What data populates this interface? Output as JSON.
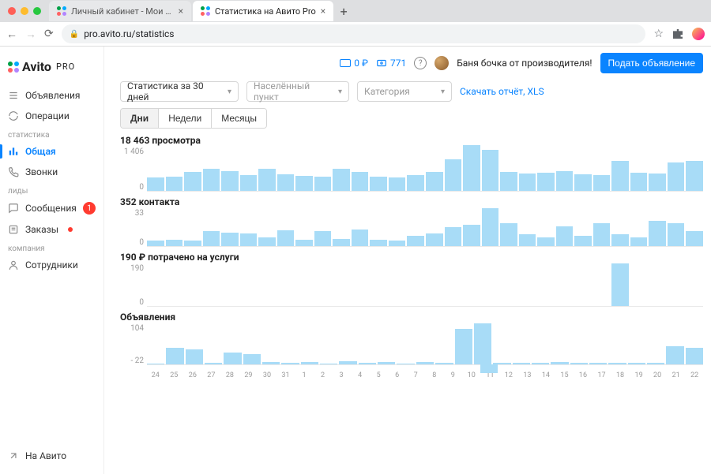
{
  "browser": {
    "tabs": [
      {
        "title": "Личный кабинет - Мои объяв",
        "active": false
      },
      {
        "title": "Статистика на Авито Pro",
        "active": true
      }
    ],
    "url": "pro.avito.ru/statistics"
  },
  "logo": {
    "brand": "Avito",
    "suffix": "PRO"
  },
  "sidebar": {
    "items": [
      {
        "label": "Объявления",
        "icon": "stack-icon"
      },
      {
        "label": "Операции",
        "icon": "refresh-icon"
      }
    ],
    "groups": [
      {
        "label": "статистика",
        "items": [
          {
            "label": "Общая",
            "icon": "bars-icon",
            "active": true
          },
          {
            "label": "Звонки",
            "icon": "phone-icon"
          }
        ]
      },
      {
        "label": "лиды",
        "items": [
          {
            "label": "Сообщения",
            "icon": "chat-icon",
            "badge": "1"
          },
          {
            "label": "Заказы",
            "icon": "list-icon",
            "dot": true
          }
        ]
      },
      {
        "label": "компания",
        "items": [
          {
            "label": "Сотрудники",
            "icon": "person-icon"
          }
        ]
      }
    ],
    "footer": {
      "label": "На Авито"
    }
  },
  "topbar": {
    "wallet": "0 ₽",
    "views": "771",
    "listing": "Баня бочка от производителя!",
    "cta": "Подать объявление"
  },
  "controls": {
    "period": "Статистика за 30 дней",
    "city_placeholder": "Населённый пункт",
    "category_placeholder": "Категория",
    "download": "Скачать отчёт, XLS",
    "granularity": {
      "day": "Дни",
      "week": "Недели",
      "month": "Месяцы"
    }
  },
  "charts": {
    "views_title": "18 463 просмотра",
    "contacts_title": "352 контакта",
    "spend_title": "190 ₽ потрачено на услуги",
    "ads_title": "Объявления",
    "y_views_top": "1 406",
    "y_views_bot": "0",
    "y_contacts_top": "33",
    "y_contacts_bot": "0",
    "y_spend_top": "190",
    "y_spend_bot": "0",
    "y_ads_top": "104",
    "y_ads_bot": "- 22"
  },
  "chart_data": [
    {
      "type": "bar",
      "title": "18 463 просмотра",
      "ylabel": "",
      "xlabel": "",
      "ylim": [
        0,
        1406
      ],
      "categories": [
        "24",
        "25",
        "26",
        "27",
        "28",
        "29",
        "30",
        "31",
        "1",
        "2",
        "3",
        "4",
        "5",
        "6",
        "7",
        "8",
        "9",
        "10",
        "11",
        "12",
        "13",
        "14",
        "15",
        "16",
        "17",
        "18",
        "19",
        "20",
        "21",
        "22"
      ],
      "values": [
        420,
        450,
        600,
        700,
        640,
        500,
        700,
        520,
        470,
        450,
        700,
        600,
        450,
        430,
        500,
        600,
        1000,
        1450,
        1300,
        600,
        550,
        580,
        630,
        540,
        510,
        950,
        580,
        560,
        900,
        950
      ]
    },
    {
      "type": "bar",
      "title": "352 контакта",
      "ylim": [
        0,
        33
      ],
      "categories": [
        "24",
        "25",
        "26",
        "27",
        "28",
        "29",
        "30",
        "31",
        "1",
        "2",
        "3",
        "4",
        "5",
        "6",
        "7",
        "8",
        "9",
        "10",
        "11",
        "12",
        "13",
        "14",
        "15",
        "16",
        "17",
        "18",
        "19",
        "20",
        "21",
        "22"
      ],
      "values": [
        5,
        6,
        5,
        14,
        13,
        12,
        8,
        15,
        6,
        14,
        7,
        16,
        6,
        5,
        10,
        12,
        18,
        20,
        36,
        22,
        11,
        8,
        19,
        10,
        22,
        11,
        8,
        24,
        22,
        14
      ]
    },
    {
      "type": "bar",
      "title": "190 ₽ потрачено на услуги",
      "ylim": [
        0,
        190
      ],
      "categories": [
        "24",
        "25",
        "26",
        "27",
        "28",
        "29",
        "30",
        "31",
        "1",
        "2",
        "3",
        "4",
        "5",
        "6",
        "7",
        "8",
        "9",
        "10",
        "11",
        "12",
        "13",
        "14",
        "15",
        "16",
        "17",
        "18",
        "19",
        "20",
        "21",
        "22"
      ],
      "values": [
        0,
        0,
        0,
        0,
        0,
        0,
        0,
        0,
        0,
        0,
        0,
        0,
        0,
        0,
        0,
        0,
        0,
        0,
        0,
        0,
        0,
        0,
        0,
        0,
        0,
        190,
        0,
        0,
        0,
        0
      ]
    },
    {
      "type": "bar",
      "title": "Объявления",
      "ylim": [
        -22,
        104
      ],
      "categories": [
        "24",
        "25",
        "26",
        "27",
        "28",
        "29",
        "30",
        "31",
        "1",
        "2",
        "3",
        "4",
        "5",
        "6",
        "7",
        "8",
        "9",
        "10",
        "11",
        "12",
        "13",
        "14",
        "15",
        "16",
        "17",
        "18",
        "19",
        "20",
        "21",
        "22"
      ],
      "values": [
        3,
        42,
        38,
        5,
        30,
        26,
        6,
        4,
        6,
        3,
        8,
        5,
        6,
        3,
        6,
        4,
        90,
        104,
        -22,
        5,
        4,
        4,
        6,
        5,
        5,
        4,
        4,
        4,
        46,
        42
      ]
    }
  ],
  "x_categories": [
    "24",
    "25",
    "26",
    "27",
    "28",
    "29",
    "30",
    "31",
    "1",
    "2",
    "3",
    "4",
    "5",
    "6",
    "7",
    "8",
    "9",
    "10",
    "11",
    "12",
    "13",
    "14",
    "15",
    "16",
    "17",
    "18",
    "19",
    "20",
    "21",
    "22"
  ]
}
